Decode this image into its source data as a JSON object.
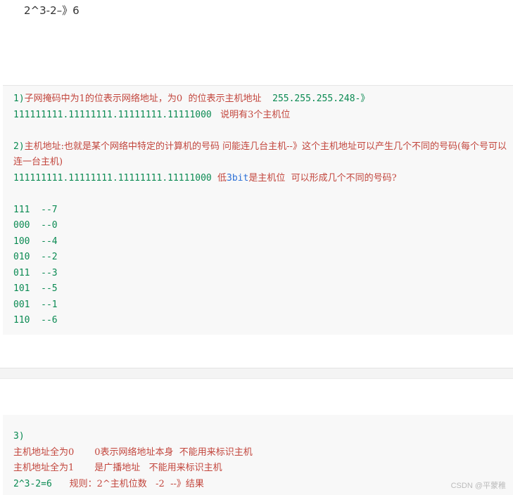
{
  "top_text": "2^3-2–》6",
  "block1": {
    "l1_num": "1)",
    "l1_red": "子网掩码中为1的位表示网络地址，为0  的位表示主机地址",
    "l1_tail": "  255.255.255.248-》",
    "l2_num": "111111111.11111111.11111111.11111000",
    "l2_red": "   说明有3个主机位",
    "l4_num": "2)",
    "l4_red": "主机地址:也就是某个网络中特定的计算机的号码   问能连几台主机--》这个主机地址可以产生几个不同的号码(每个号可以连一台主机)",
    "l6_num": "111111111.11111111.11111111.11111000",
    "l6_red1": "  低",
    "l6_blue": "3bit",
    "l6_red2": "是主机位  可以形成几个不同的号码?",
    "pairs": [
      {
        "bits": "111",
        "val": "  --7"
      },
      {
        "bits": "000",
        "val": "  --0"
      },
      {
        "bits": "100",
        "val": "  --4"
      },
      {
        "bits": "010",
        "val": "  --2"
      },
      {
        "bits": "011",
        "val": "  --3"
      },
      {
        "bits": "101",
        "val": "  --5"
      },
      {
        "bits": "001",
        "val": "  --1"
      },
      {
        "bits": "110",
        "val": "  --6"
      }
    ]
  },
  "block2": {
    "l1": "3)",
    "l2_red1": "主机地址全为0",
    "l2_red2": "       0表示网络地址本身  不能用来标识主机",
    "l3_red1": "主机地址全为1",
    "l3_red2": "       是广播地址   不能用来标识主机",
    "l4_num": "2^3-2=6",
    "l4_red": "      规则：2^主机位数   -2  --》结果"
  },
  "watermark": "CSDN @平蒙稚"
}
